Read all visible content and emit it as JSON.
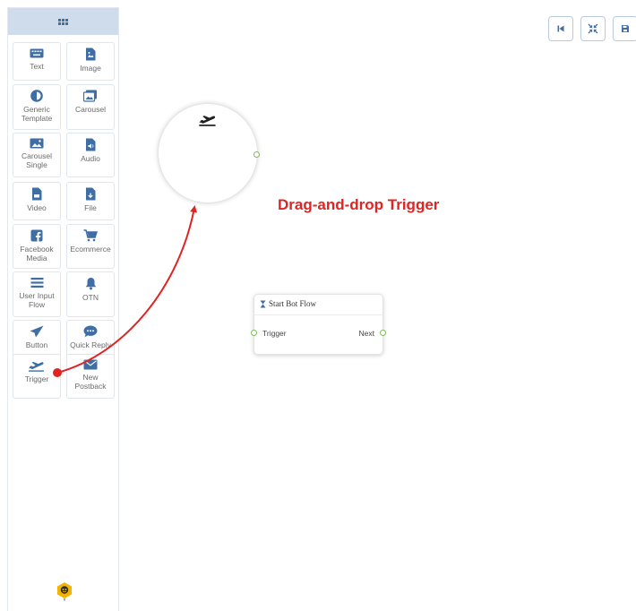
{
  "palette": {
    "items": [
      {
        "label": "Text",
        "icon": "keyboard-icon"
      },
      {
        "label": "Image",
        "icon": "image-file-icon"
      },
      {
        "label": "Generic Template",
        "icon": "contrast-icon"
      },
      {
        "label": "Carousel",
        "icon": "carousel-icon"
      },
      {
        "label": "Carousel Single",
        "icon": "picture-icon"
      },
      {
        "label": "Audio",
        "icon": "audio-file-icon"
      },
      {
        "label": "Video",
        "icon": "video-file-icon"
      },
      {
        "label": "File",
        "icon": "download-file-icon"
      },
      {
        "label": "Facebook Media",
        "icon": "facebook-icon"
      },
      {
        "label": "Ecommerce",
        "icon": "cart-icon"
      },
      {
        "label": "User Input Flow",
        "icon": "list-icon"
      },
      {
        "label": "OTN",
        "icon": "bell-icon"
      },
      {
        "label": "Button",
        "icon": "send-icon"
      },
      {
        "label": "Quick Reply",
        "icon": "chat-bubble-icon"
      },
      {
        "label": "Trigger",
        "icon": "plane-departure-icon"
      },
      {
        "label": "New Postback",
        "icon": "envelope-icon"
      }
    ]
  },
  "toolbar": {
    "buttons": [
      {
        "name": "first-page-button",
        "icon": "skip-back-icon"
      },
      {
        "name": "fit-screen-button",
        "icon": "compress-icon"
      },
      {
        "name": "save-button",
        "icon": "floppy-icon"
      }
    ]
  },
  "canvas": {
    "annotation": "Drag-and-drop Trigger",
    "trigger_node": {
      "icon": "plane-departure-icon"
    },
    "start_node": {
      "title": "Start Bot Flow",
      "input_label": "Trigger",
      "output_label": "Next"
    }
  },
  "colors": {
    "accent": "#3f6ea5",
    "annotation": "#e02424",
    "port": "#7dbb5f"
  }
}
